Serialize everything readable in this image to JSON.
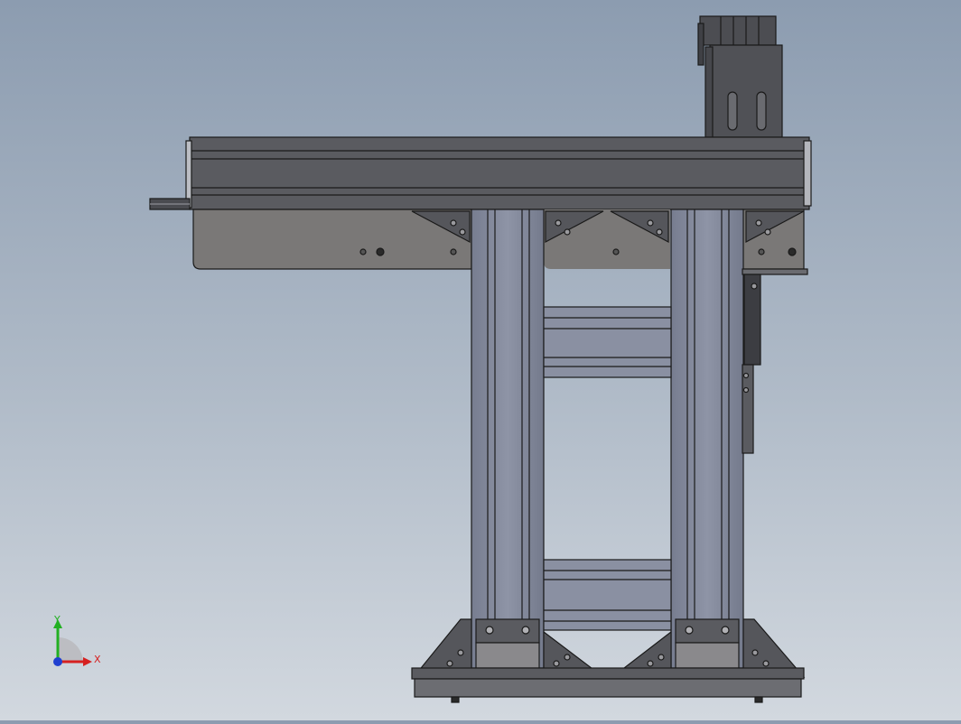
{
  "viewport": {
    "background_top": "#8c9cb0",
    "background_bottom": "#d2d8df",
    "body_color": "#5a5b60",
    "rail_color": "#848a9c",
    "plate_color": "#7a7877",
    "edge_color": "#1a1a1a"
  },
  "triad": {
    "x_label": "X",
    "y_label": "Y",
    "x_color": "#d62020",
    "y_color": "#22b022",
    "z_color": "#2040d0"
  }
}
